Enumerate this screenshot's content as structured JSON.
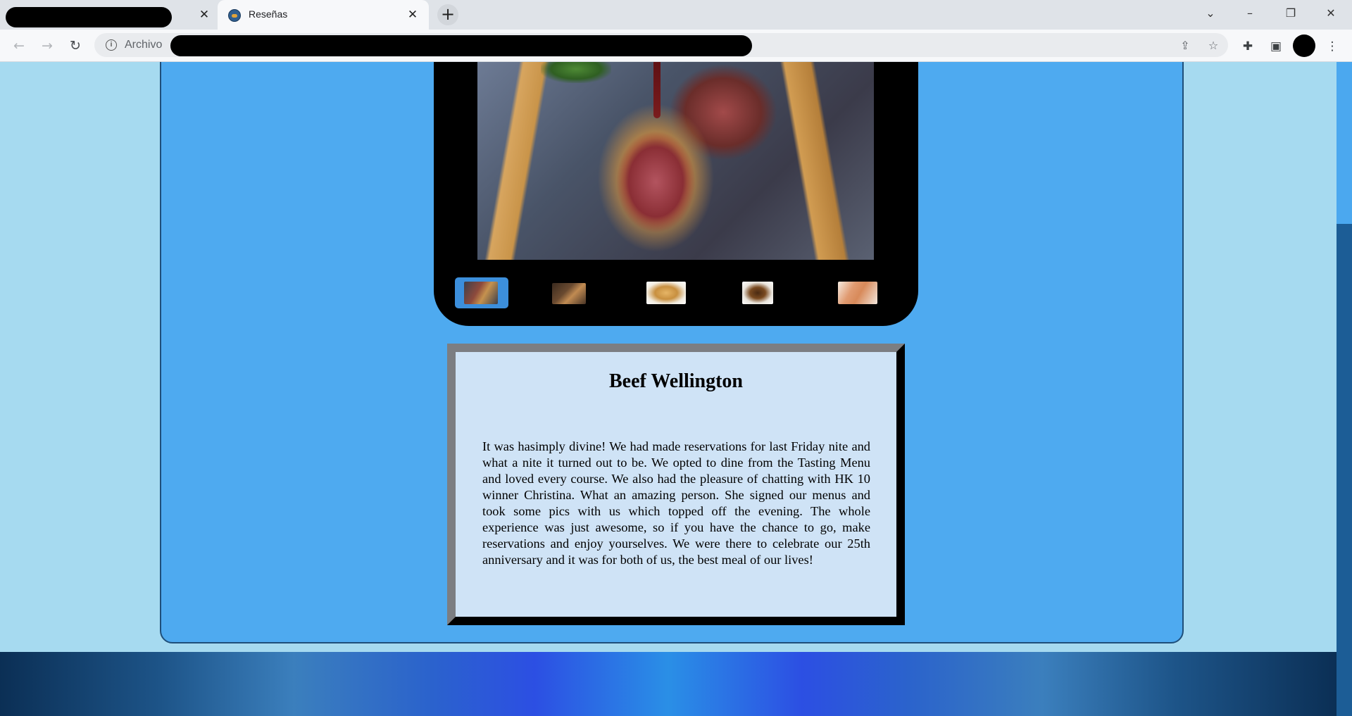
{
  "browser": {
    "tabs": [
      {
        "label": "",
        "redacted": true
      },
      {
        "label": "Reseñas",
        "active": true
      }
    ],
    "address": {
      "prefix": "Archivo",
      "redacted": true
    },
    "icons": {
      "back": "arrow-left-icon",
      "forward": "arrow-right-icon",
      "reload": "reload-icon",
      "info": "info-icon",
      "share": "share-icon",
      "bookmark": "star-icon",
      "extensions": "puzzle-icon",
      "sidepanel": "sidepanel-icon",
      "menu": "kebab-menu-icon"
    }
  },
  "gallery": {
    "main_image": "Beef Wellington slices with sauce",
    "thumbnails": [
      {
        "name": "beef-wellington",
        "selected": true
      },
      {
        "name": "thumb-2",
        "selected": false
      },
      {
        "name": "thumb-3",
        "selected": false
      },
      {
        "name": "thumb-4",
        "selected": false
      },
      {
        "name": "thumb-5",
        "selected": false
      }
    ]
  },
  "review": {
    "title": "Beef Wellington",
    "body": "It was hasimply divine! We had made reservations for last Friday nite and what a nite it turned out to be. We opted to dine from the Tasting Menu and loved every course. We also had the pleasure of chatting with HK 10 winner Christina. What an amazing person. She signed our menus and took some pics with us which topped off the evening. The whole experience was just awesome, so if you have the chance to go, make reservations and enjoy yourselves. We were there to celebrate our 25th anniversary and it was for both of us, the best meal of our lives!"
  },
  "colors": {
    "page_bg": "#a6daf0",
    "card_bg": "#4eaaf0",
    "review_bg": "#cfe3f6",
    "thumb_selected": "#3c8fdc"
  }
}
